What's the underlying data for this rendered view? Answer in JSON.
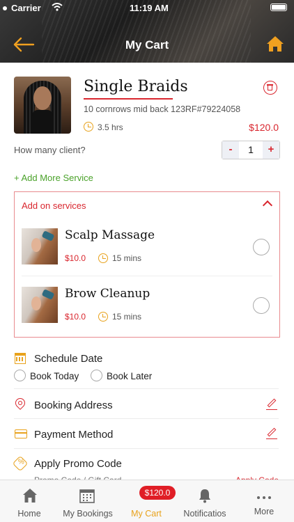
{
  "status_bar": {
    "carrier": "Carrier",
    "time": "11:19 AM"
  },
  "header": {
    "title": "My Cart"
  },
  "cart_item": {
    "name": "Single Braids",
    "description": "10 cornrows mid back 123RF#79224058",
    "duration": "3.5 hrs",
    "price": "$120.0"
  },
  "clients": {
    "label": "How many client?",
    "minus": "-",
    "qty": "1",
    "plus": "+"
  },
  "add_more": "+ Add More Service",
  "addons": {
    "title": "Add on services",
    "items": [
      {
        "name": "Scalp Massage",
        "price": "$10.0",
        "duration": "15 mins"
      },
      {
        "name": "Brow Cleanup",
        "price": "$10.0",
        "duration": "15 mins"
      }
    ]
  },
  "schedule": {
    "label": "Schedule Date",
    "options": [
      "Book Today",
      "Book Later"
    ]
  },
  "booking_address": {
    "label": "Booking Address"
  },
  "payment": {
    "label": "Payment Method"
  },
  "promo": {
    "label": "Apply Promo Code",
    "placeholder": "Promo Code / Gift Card",
    "apply": "Apply Code"
  },
  "tabbar": {
    "badge": "$120.0",
    "tabs": [
      "Home",
      "My Bookings",
      "My Cart",
      "Notificatios",
      "More"
    ]
  },
  "colors": {
    "accent": "#e8a21c",
    "red": "#d9262e",
    "green": "#4aa22a"
  }
}
